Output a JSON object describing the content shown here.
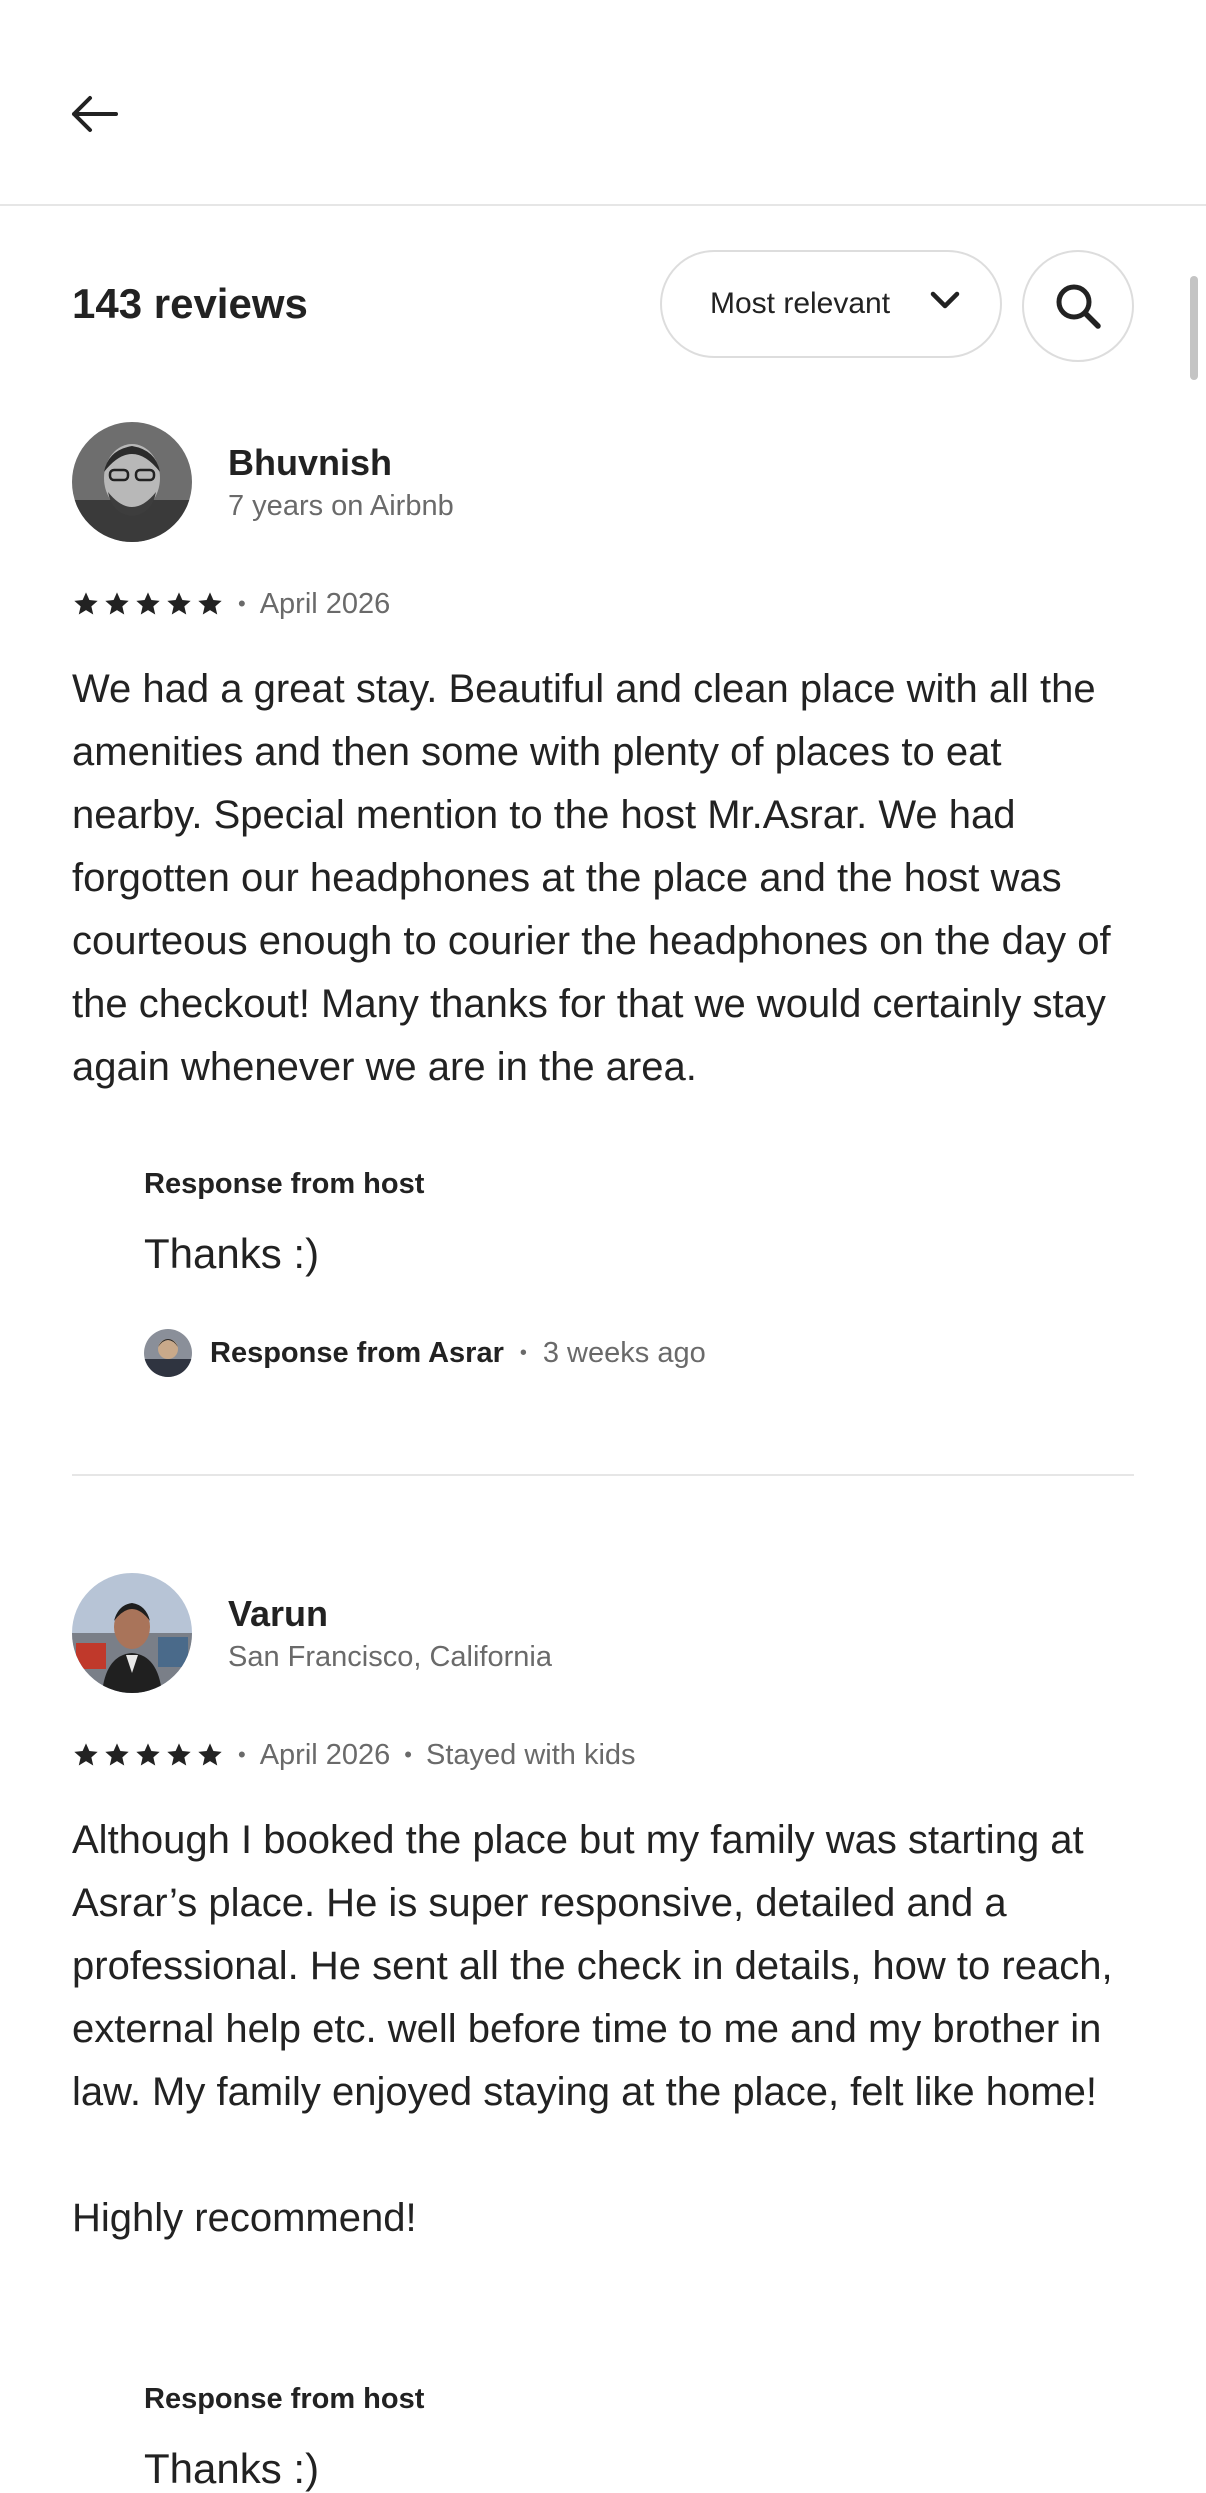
{
  "header": {
    "review_count": "143 reviews",
    "sort_label": "Most relevant"
  },
  "icons": {
    "back": "arrow-left-icon",
    "sort": "chevron-down-icon",
    "search": "search-icon",
    "star": "star-icon"
  },
  "reviews": [
    {
      "name": "Bhuvnish",
      "subtitle": "7 years on Airbnb",
      "rating": 5,
      "date": "April 2026",
      "text": "We had a great stay. Beautiful and clean place with all the amenities and then some with plenty of places to eat nearby. Special mention to the host Mr.Asrar. We had forgotten our headphones at the place and the host was courteous enough to courier the headphones on the day of the checkout! Many thanks for that we would certainly stay again whenever we are in the area.",
      "response_label": "Response from host",
      "response_text": "Thanks :)",
      "responder": "Response from Asrar",
      "response_time": "3 weeks ago"
    },
    {
      "name": "Varun",
      "subtitle": "San Francisco, California",
      "rating": 5,
      "date": "April 2026",
      "trip_type": "Stayed with kids",
      "text": "Although I booked the place but my family was starting at Asrar’s place. He is super responsive, detailed and a professional. He sent all the check in details, how to reach, external help etc. well before time to me and my brother in law. My family enjoyed staying at the place, felt like home!\n\nHighly recommend!",
      "response_label": "Response from host",
      "response_text": "Thanks :)"
    }
  ]
}
